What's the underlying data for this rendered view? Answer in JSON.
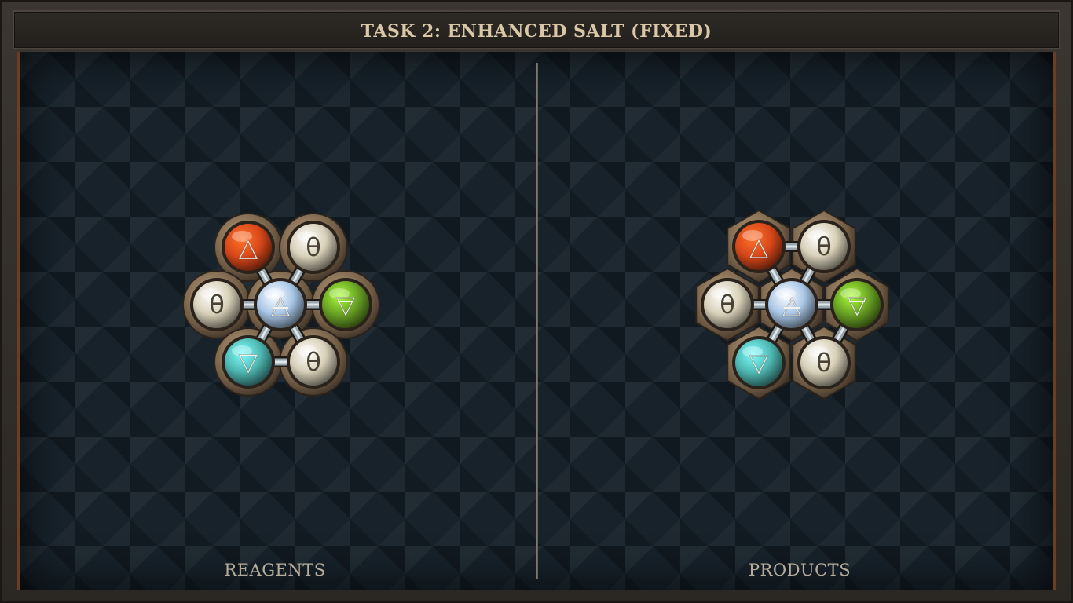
{
  "title": "TASK 2: ENHANCED SALT (FIXED)",
  "panels": {
    "left_label": "REAGENTS",
    "right_label": "PRODUCTS"
  },
  "colors": {
    "fire": "#d9481a",
    "water": "#4fb8b3",
    "air": "#a9c7e8",
    "earth": "#6aa324",
    "salt": "#d8d0b8",
    "frame_copper": "#6b3d22"
  },
  "symbols": {
    "fire": "△",
    "water": "▽",
    "air": "△",
    "earth": "▽",
    "salt": "θ"
  },
  "reagents": {
    "atoms": [
      "fire",
      "salt",
      "salt",
      "air",
      "earth",
      "water",
      "salt"
    ],
    "bonds": [
      [
        3,
        0
      ],
      [
        3,
        1
      ],
      [
        3,
        2
      ],
      [
        3,
        4
      ],
      [
        3,
        5
      ],
      [
        3,
        6
      ],
      [
        5,
        6
      ]
    ]
  },
  "products": {
    "atoms": [
      "fire",
      "salt",
      "salt",
      "air",
      "earth",
      "water",
      "salt"
    ],
    "bonds": [
      [
        0,
        1
      ],
      [
        3,
        0
      ],
      [
        3,
        1
      ],
      [
        3,
        2
      ],
      [
        3,
        4
      ],
      [
        3,
        5
      ],
      [
        3,
        6
      ],
      [
        4,
        6
      ]
    ]
  }
}
